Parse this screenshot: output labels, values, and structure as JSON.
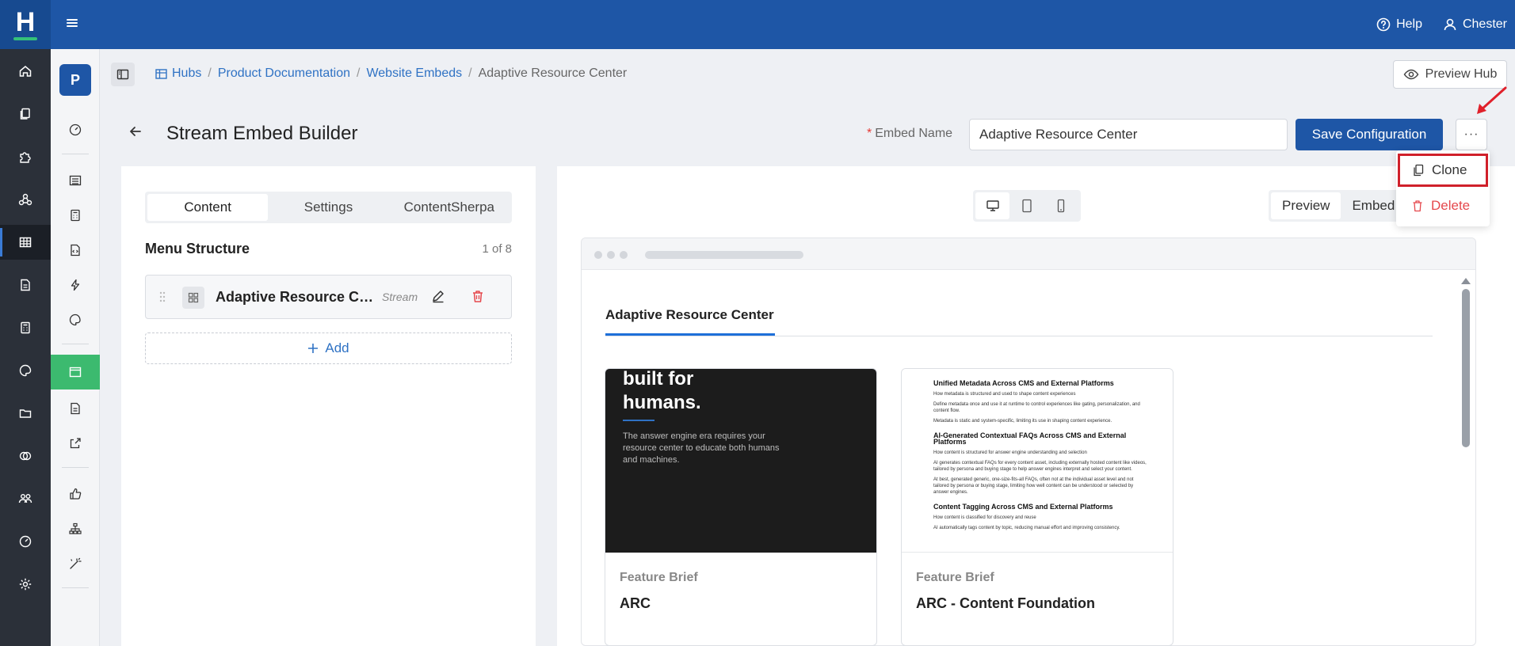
{
  "topbar": {
    "logo_letter": "H",
    "help_label": "Help",
    "user_label": "Chester"
  },
  "secondary_sidebar": {
    "avatar_letter": "P"
  },
  "breadcrumb": {
    "items": [
      "Hubs",
      "Product Documentation",
      "Website Embeds"
    ],
    "current": "Adaptive Resource Center"
  },
  "preview_hub_label": "Preview Hub",
  "header": {
    "title": "Stream Embed Builder",
    "embed_name_label": "Embed Name",
    "embed_name_required": "*",
    "embed_name_value": "Adaptive Resource Center",
    "save_label": "Save Configuration",
    "more_label": "···"
  },
  "dropdown": {
    "clone_label": "Clone",
    "delete_label": "Delete"
  },
  "left_panel": {
    "tabs": [
      "Content",
      "Settings",
      "ContentSherpa"
    ],
    "active_tab": "Content",
    "menu_title": "Menu Structure",
    "menu_count": "1 of 8",
    "menu_item": {
      "label": "Adaptive Resource Center",
      "type": "Stream"
    },
    "add_label": "Add"
  },
  "right_panel": {
    "modes": [
      "Preview",
      "Embed"
    ],
    "active_mode": "Preview",
    "embed_tab_label": "Adaptive Resource Center",
    "cards": [
      {
        "category": "Feature Brief",
        "title": "ARC",
        "image_heading": "built for humans.",
        "image_text": "The answer engine era requires your resource center to educate both humans and machines."
      },
      {
        "category": "Feature Brief",
        "title": "ARC - Content Foundation",
        "doc_sections": [
          {
            "heading": "Unified Metadata Across CMS and External Platforms",
            "lines": [
              "How metadata is structured and used to shape content experiences",
              "Define metadata once and use it at runtime to control experiences like gating, personalization, and content flow.",
              "Metadata is static and system-specific, limiting its use in shaping content experience."
            ]
          },
          {
            "heading": "AI-Generated Contextual FAQs Across CMS and External Platforms",
            "lines": [
              "How content is structured for answer engine understanding and selection",
              "AI generates contextual FAQs for every content asset, including externally hosted content like videos, tailored by persona and buying stage to help answer engines interpret and select your content.",
              "At best, generated generic, one-size-fits-all FAQs, often not at the individual asset level and not tailored by persona or buying stage, limiting how well content can be understood or selected by answer engines."
            ]
          },
          {
            "heading": "Content Tagging Across CMS and External Platforms",
            "lines": [
              "How content is classified for discovery and reuse",
              "AI automatically tags content by topic, reducing manual effort and improving consistency."
            ]
          }
        ]
      }
    ]
  },
  "colors": {
    "topbar": "#1e56a6",
    "rail": "#2b3039",
    "active_green": "#3cba6f",
    "link": "#2f72c4",
    "danger": "#e5484d",
    "highlight": "#d0202a"
  }
}
